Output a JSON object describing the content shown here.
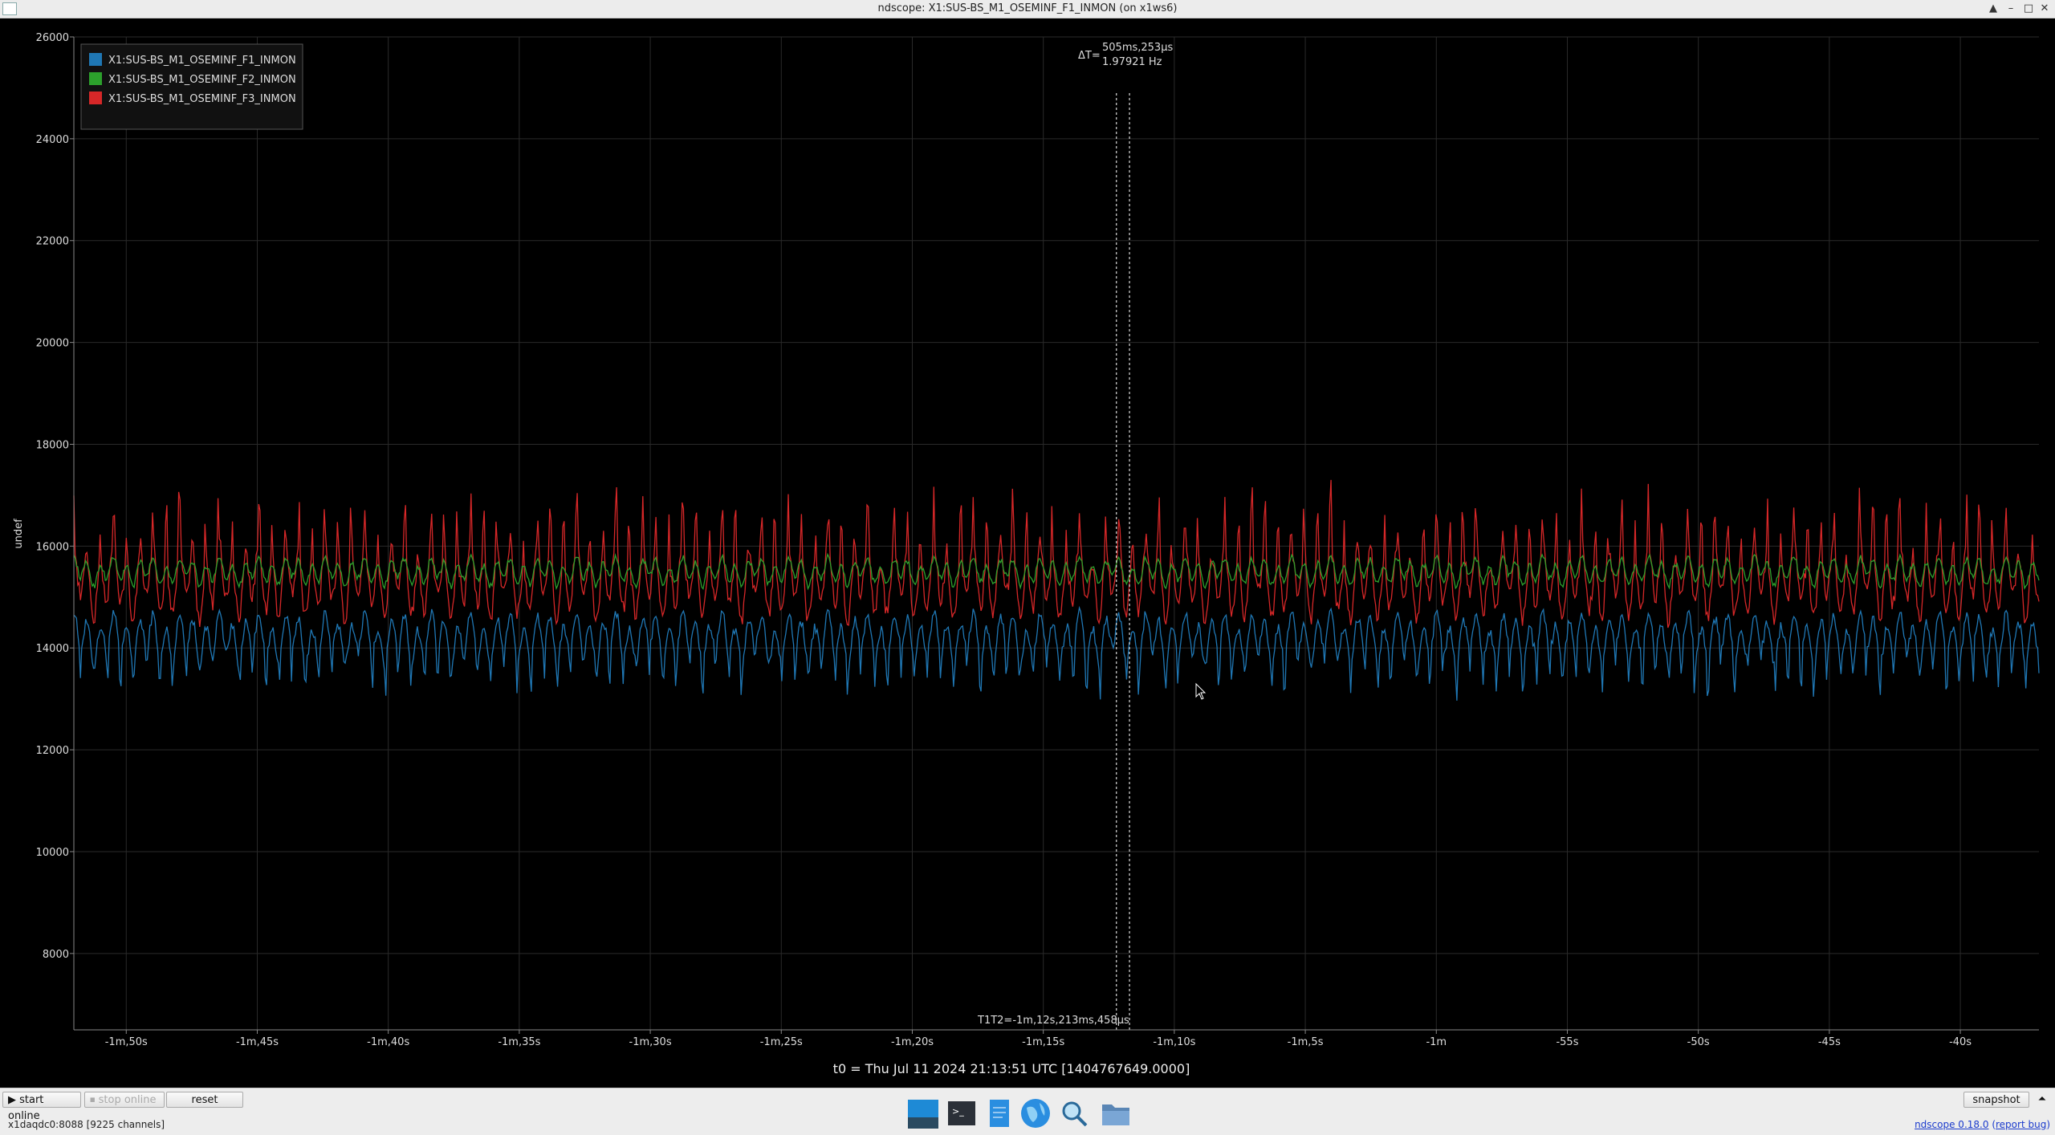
{
  "window": {
    "title": "ndscope: X1:SUS-BS_M1_OSEMINF_F1_INMON (on x1ws6)",
    "buttons": [
      "▲",
      "–",
      "□",
      "✕"
    ]
  },
  "plot": {
    "ylabel": "undef",
    "t0_label": "t0 = Thu Jul 11 2024 21:13:51 UTC [1404767649.0000]",
    "cursor": {
      "delta_label": "ΔT=",
      "delta_time": "505ms,253µs",
      "delta_freq": "1.97921 Hz",
      "t2_label": "T1T2=-1m,12s,213ms,458µs"
    },
    "legend": [
      {
        "name": "X1:SUS-BS_M1_OSEMINF_F1_INMON",
        "color": "#1f77b4"
      },
      {
        "name": "X1:SUS-BS_M1_OSEMINF_F2_INMON",
        "color": "#2ca02c"
      },
      {
        "name": "X1:SUS-BS_M1_OSEMINF_F3_INMON",
        "color": "#d62728"
      }
    ]
  },
  "chart_data": {
    "type": "line",
    "ylabel": "undef",
    "ylim": [
      6500,
      26000
    ],
    "yticks": [
      8000,
      10000,
      12000,
      14000,
      16000,
      18000,
      20000,
      22000,
      24000,
      26000
    ],
    "xlim": [
      -112,
      -37
    ],
    "xticks": [
      -110,
      -105,
      -100,
      -95,
      -90,
      -85,
      -80,
      -75,
      -70,
      -65,
      -60,
      -55,
      -50,
      -45,
      -40
    ],
    "xtick_labels": [
      "-1m,50s",
      "-1m,45s",
      "-1m,40s",
      "-1m,35s",
      "-1m,30s",
      "-1m,25s",
      "-1m,20s",
      "-1m,15s",
      "-1m,10s",
      "-1m,5s",
      "-1m",
      "-55s",
      "-50s",
      "-45s",
      "-40s"
    ],
    "grid": true,
    "legend_position": "top-left",
    "cursors_x": [
      -72.21,
      -71.71
    ],
    "series": [
      {
        "name": "X1:SUS-BS_M1_OSEMINF_F1_INMON",
        "color": "#1f77b4",
        "mean": 14200,
        "amplitude": 600,
        "min": 12000,
        "max": 15700
      },
      {
        "name": "X1:SUS-BS_M1_OSEMINF_F2_INMON",
        "color": "#2ca02c",
        "mean": 15500,
        "amplitude": 350,
        "min": 14400,
        "max": 16600
      },
      {
        "name": "X1:SUS-BS_M1_OSEMINF_F3_INMON",
        "color": "#d62728",
        "mean": 15300,
        "amplitude": 900,
        "min": 13000,
        "max": 18400
      }
    ]
  },
  "bottom": {
    "start_online": "▶ start online",
    "stop_online": "⏹ stop online",
    "reset": "reset",
    "snapshot": "snapshot",
    "expand": "⏶",
    "status": "x1daqdc0:8088 [9225 channels]",
    "version": "ndscope 0.18.0",
    "report_bug": "report bug"
  },
  "taskbar": {
    "items": [
      "desktop-icon",
      "terminal-icon",
      "text-editor-icon",
      "browser-icon",
      "search-icon",
      "file-manager-icon"
    ]
  }
}
